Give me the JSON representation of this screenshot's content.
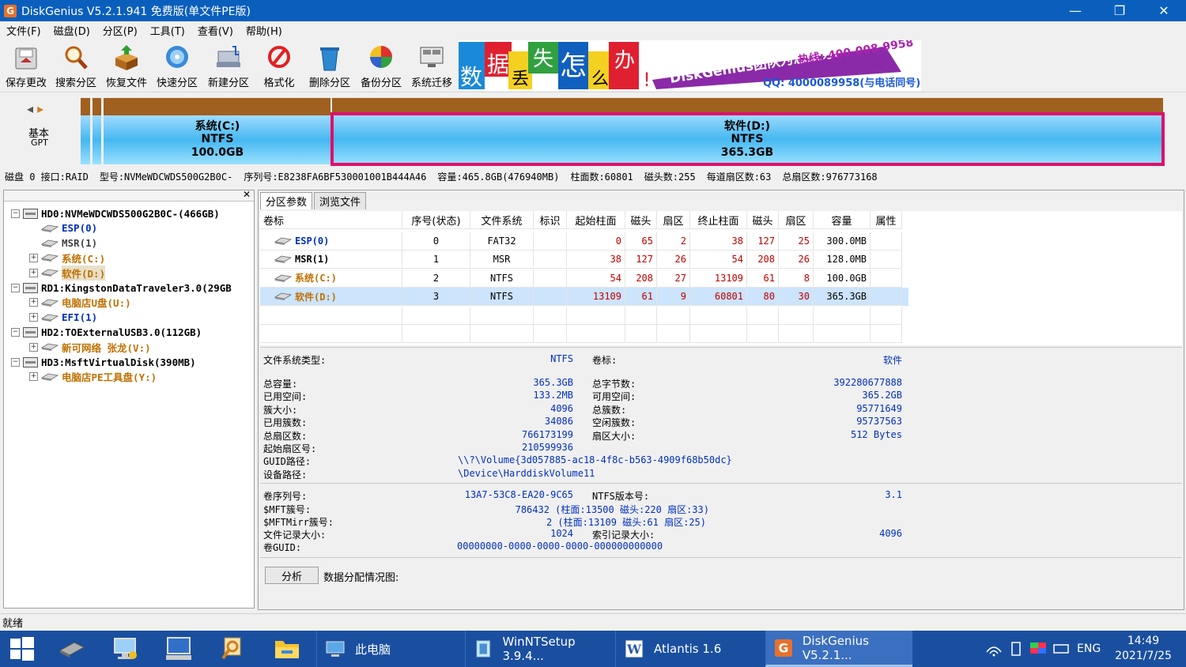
{
  "window": {
    "title": "DiskGenius V5.2.1.941 免费版(单文件PE版)",
    "app_icon": "G"
  },
  "menu": [
    "文件(F)",
    "磁盘(D)",
    "分区(P)",
    "工具(T)",
    "查看(V)",
    "帮助(H)"
  ],
  "toolbar": [
    {
      "label": "保存更改",
      "icon": "save-disk-icon"
    },
    {
      "label": "搜索分区",
      "icon": "magnifier-icon"
    },
    {
      "label": "恢复文件",
      "icon": "recover-box-icon"
    },
    {
      "label": "快速分区",
      "icon": "quick-partition-icon"
    },
    {
      "label": "新建分区",
      "icon": "new-partition-icon"
    },
    {
      "label": "格式化",
      "icon": "format-icon"
    },
    {
      "label": "删除分区",
      "icon": "trash-icon"
    },
    {
      "label": "备份分区",
      "icon": "backup-icon"
    },
    {
      "label": "系统迁移",
      "icon": "migrate-icon"
    }
  ],
  "banner": {
    "chars": [
      "数",
      "据",
      "丢",
      "失",
      "怎",
      "么",
      "办",
      "!"
    ],
    "slogan": "DiskGenius团队为您服务!",
    "phone": "热线: 400-008-9958",
    "qq": "QQ: 4000089958(与电话同号)"
  },
  "diskmap": {
    "nav_label_1": "基本",
    "nav_label_2": "GPT",
    "partitions": [
      {
        "name": "系统(C:)",
        "fs": "NTFS",
        "size": "100.0GB"
      },
      {
        "name": "软件(D:)",
        "fs": "NTFS",
        "size": "365.3GB"
      }
    ]
  },
  "diskinfo": [
    "磁盘 0 接口:RAID",
    "型号:NVMeWDCWDS500G2B0C-",
    "序列号:E8238FA6BF530001001B444A46",
    "容量:465.8GB(476940MB)",
    "柱面数:60801",
    "磁头数:255",
    "每道扇区数:63",
    "总扇区数:976773168"
  ],
  "tree": [
    {
      "level": 0,
      "toggle": "−",
      "type": "disk",
      "label": "HD0:NVMeWDCWDS500G2B0C-(466GB)",
      "color": "#000000"
    },
    {
      "level": 1,
      "toggle": "",
      "type": "part",
      "label": "ESP(0)",
      "color": "#0030c0"
    },
    {
      "level": 1,
      "toggle": "",
      "type": "part",
      "label": "MSR(1)",
      "color": "#404040"
    },
    {
      "level": 1,
      "toggle": "+",
      "type": "part",
      "label": "系统(C:)",
      "color": "#c07000"
    },
    {
      "level": 1,
      "toggle": "+",
      "type": "part",
      "label": "软件(D:)",
      "color": "#c07000",
      "selected": true
    },
    {
      "level": 0,
      "toggle": "−",
      "type": "disk",
      "label": "RD1:KingstonDataTraveler3.0(29GB",
      "color": "#000000"
    },
    {
      "level": 1,
      "toggle": "+",
      "type": "part",
      "label": "电脑店U盘(U:)",
      "color": "#c07000"
    },
    {
      "level": 1,
      "toggle": "+",
      "type": "part",
      "label": "EFI(1)",
      "color": "#0030c0"
    },
    {
      "level": 0,
      "toggle": "−",
      "type": "disk",
      "label": "HD2:TOExternalUSB3.0(112GB)",
      "color": "#000000"
    },
    {
      "level": 1,
      "toggle": "+",
      "type": "part",
      "label": "新可网络 张龙(V:)",
      "color": "#c07000"
    },
    {
      "level": 0,
      "toggle": "−",
      "type": "disk",
      "label": "HD3:MsftVirtualDisk(390MB)",
      "color": "#000000"
    },
    {
      "level": 1,
      "toggle": "+",
      "type": "part",
      "label": "电脑店PE工具盘(Y:)",
      "color": "#c07000"
    }
  ],
  "tabs": [
    "分区参数",
    "浏览文件"
  ],
  "table": {
    "headers": [
      "卷标",
      "序号(状态)",
      "文件系统",
      "标识",
      "起始柱面",
      "磁头",
      "扇区",
      "终止柱面",
      "磁头",
      "扇区",
      "容量",
      "属性"
    ],
    "rows": [
      {
        "label": "ESP(0)",
        "label_color": "blue",
        "cells": [
          "0",
          "FAT32",
          "",
          "0",
          "65",
          "2",
          "38",
          "127",
          "25",
          "300.0MB",
          ""
        ]
      },
      {
        "label": "MSR(1)",
        "label_color": "black",
        "cells": [
          "1",
          "MSR",
          "",
          "38",
          "127",
          "26",
          "54",
          "208",
          "26",
          "128.0MB",
          ""
        ]
      },
      {
        "label": "系统(C:)",
        "label_color": "org",
        "cells": [
          "2",
          "NTFS",
          "",
          "54",
          "208",
          "27",
          "13109",
          "61",
          "8",
          "100.0GB",
          ""
        ]
      },
      {
        "label": "软件(D:)",
        "label_color": "org",
        "selected": true,
        "cells": [
          "3",
          "NTFS",
          "",
          "13109",
          "61",
          "9",
          "60801",
          "80",
          "30",
          "365.3GB",
          ""
        ]
      }
    ]
  },
  "details": {
    "fs_type_label": "文件系统类型:",
    "fs_type_value": "NTFS",
    "vol_label_label": "卷标:",
    "vol_label_value": "软件",
    "left": [
      [
        "总容量:",
        "365.3GB"
      ],
      [
        "已用空间:",
        "133.2MB"
      ],
      [
        "簇大小:",
        "4096"
      ],
      [
        "已用簇数:",
        "34086"
      ],
      [
        "总扇区数:",
        "766173199"
      ],
      [
        "起始扇区号:",
        "210599936"
      ]
    ],
    "right": [
      [
        "总字节数:",
        "392280677888"
      ],
      [
        "可用空间:",
        "365.2GB"
      ],
      [
        "总簇数:",
        "95771649"
      ],
      [
        "空闲簇数:",
        "95737563"
      ],
      [
        "扇区大小:",
        "512 Bytes"
      ]
    ],
    "guid_path_label": "GUID路径:",
    "guid_path_value": "\\\\?\\Volume{3d057885-ac18-4f8c-b563-4909f68b50dc}",
    "device_path_label": "设备路径:",
    "device_path_value": "\\Device\\HarddiskVolume11",
    "serial_label": "卷序列号:",
    "serial_value": "13A7-53C8-EA20-9C65",
    "ntfs_ver_label": "NTFS版本号:",
    "ntfs_ver_value": "3.1",
    "mft_label": "$MFT簇号:",
    "mft_value": "786432 (柱面:13500 磁头:220 扇区:33)",
    "mftmirr_label": "$MFTMirr簇号:",
    "mftmirr_value": "2 (柱面:13109 磁头:61 扇区:25)",
    "frs_label": "文件记录大小:",
    "frs_value": "1024",
    "irs_label": "索引记录大小:",
    "irs_value": "4096",
    "vguid_label": "卷GUID:",
    "vguid_value": "00000000-0000-0000-0000-000000000000",
    "analyze_button": "分析",
    "alloc_label": "数据分配情况图:"
  },
  "status": "就绪",
  "taskbar": {
    "buttons": [
      {
        "label": "此电脑",
        "icon": "this-pc-icon"
      },
      {
        "label": "WinNTSetup 3.9.4...",
        "icon": "winntsetup-icon"
      },
      {
        "label": "Atlantis 1.6",
        "icon": "atlantis-icon"
      },
      {
        "label": "DiskGenius V5.2.1...",
        "icon": "diskgenius-icon",
        "active": true
      }
    ],
    "lang": "ENG",
    "time": "14:49",
    "date": "2021/7/25"
  }
}
